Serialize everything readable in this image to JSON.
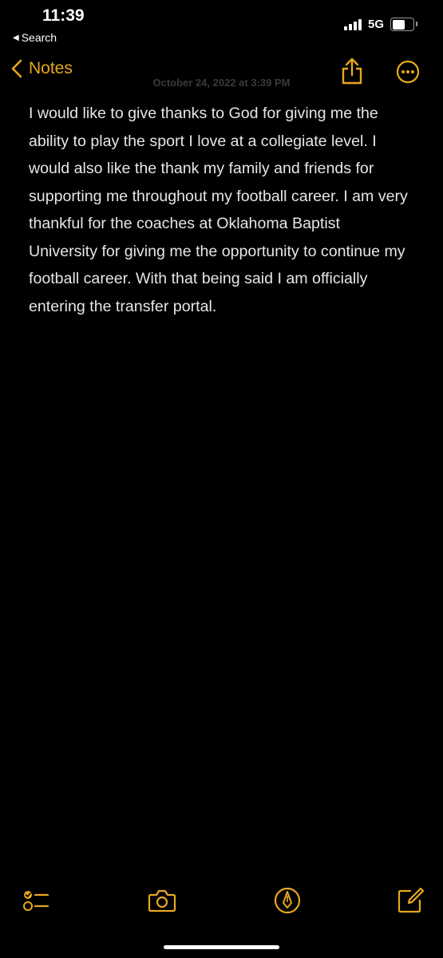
{
  "status_bar": {
    "time": "11:39",
    "back_app": "Search",
    "network": "5G",
    "battery_level": 0.62
  },
  "nav": {
    "back_label": "Notes",
    "faded_date": "October 24, 2022 at 3:39 PM",
    "share_icon": "share-icon",
    "more_icon": "ellipsis-circle-icon"
  },
  "note": {
    "body": "I would like to give thanks to God for giving me the ability to play the sport I love at a collegiate level. I would also like the thank my family and friends for supporting me throughout my football career. I am very thankful for the coaches at Oklahoma Baptist University for giving me the opportunity to continue my football career. With that being said I am officially entering the transfer portal."
  },
  "toolbar": {
    "checklist_icon": "checklist-icon",
    "camera_icon": "camera-icon",
    "markup_icon": "markup-pen-icon",
    "compose_icon": "compose-icon"
  },
  "colors": {
    "accent": "#e7a81e",
    "background": "#000000",
    "text": "#e6e6e6"
  }
}
